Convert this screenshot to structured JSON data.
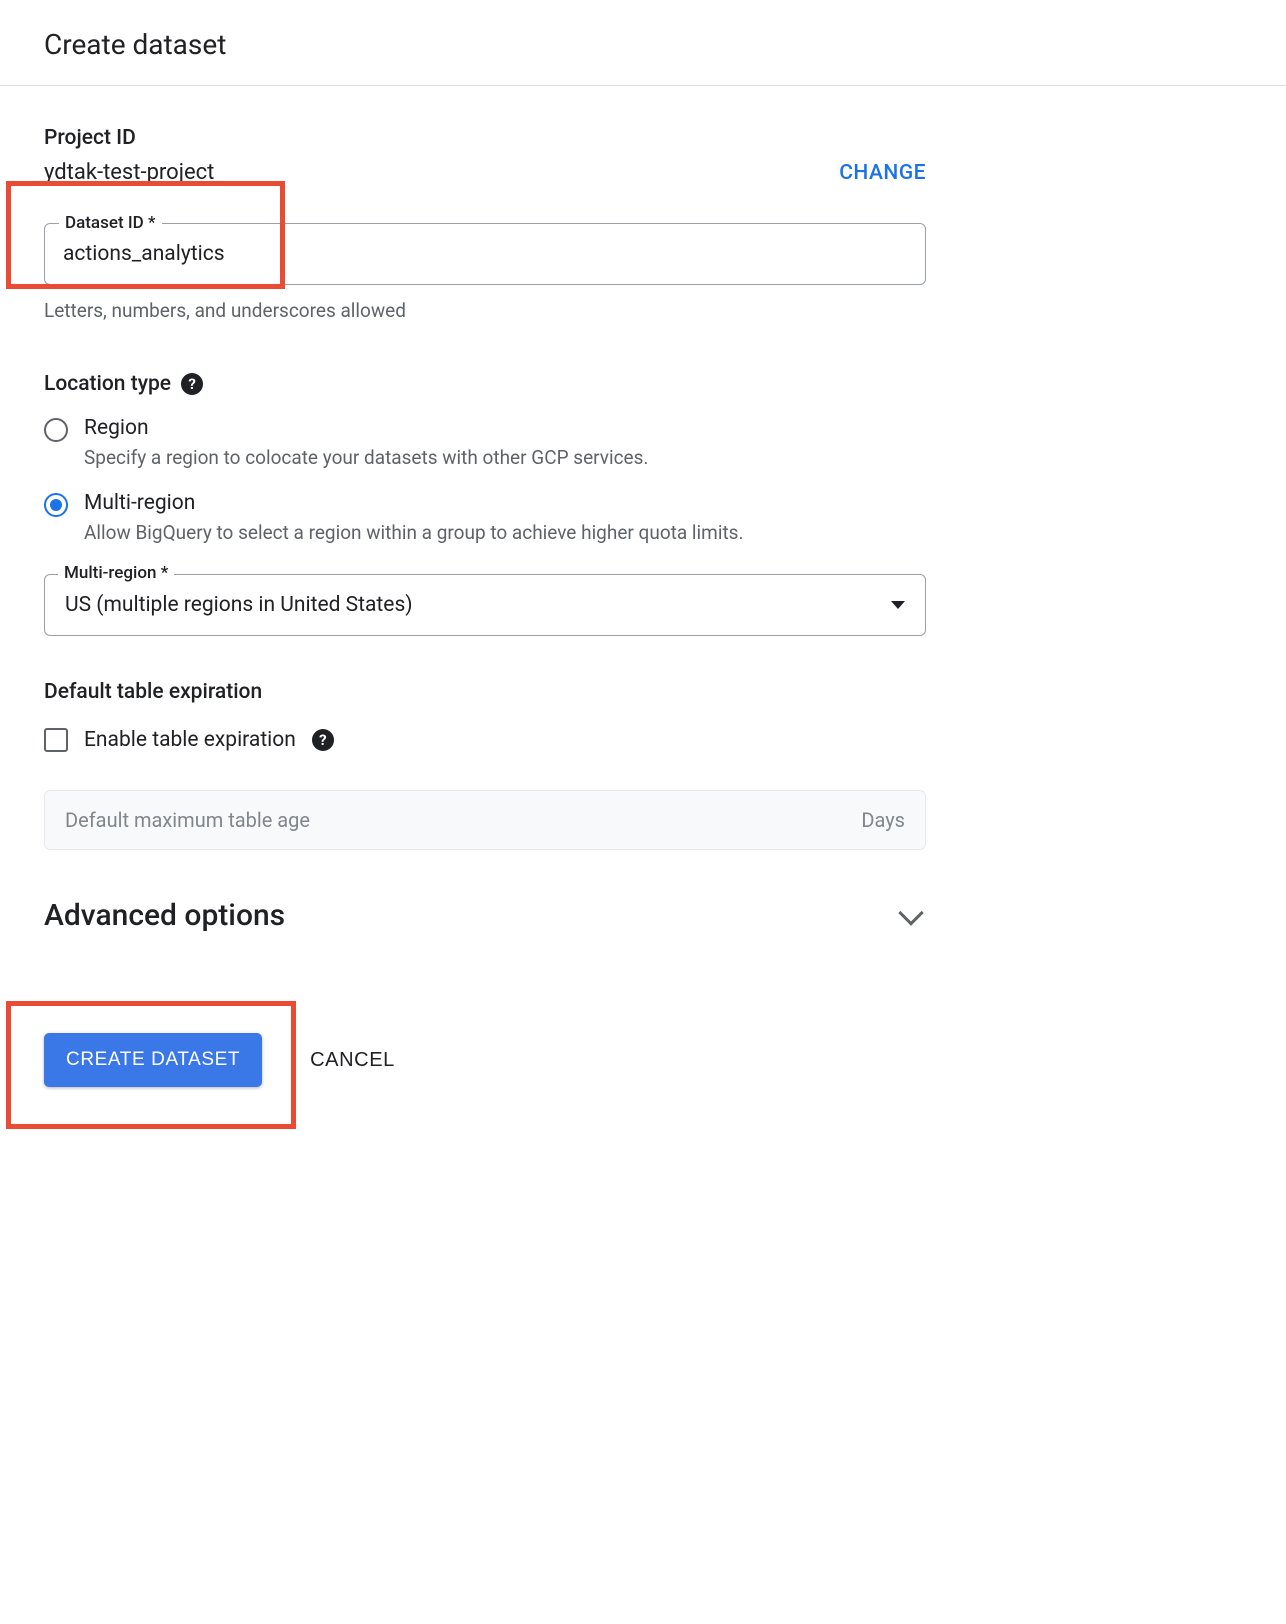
{
  "page": {
    "title": "Create dataset"
  },
  "project": {
    "label": "Project ID",
    "value": "ydtak-test-project",
    "change_label": "CHANGE"
  },
  "dataset_id": {
    "label": "Dataset ID *",
    "value": "actions_analytics",
    "helper": "Letters, numbers, and underscores allowed"
  },
  "location": {
    "section_label": "Location type",
    "options": [
      {
        "label": "Region",
        "desc": "Specify a region to colocate your datasets with other GCP services.",
        "selected": false
      },
      {
        "label": "Multi-region",
        "desc": "Allow BigQuery to select a region within a group to achieve higher quota limits.",
        "selected": true
      }
    ],
    "select_label": "Multi-region *",
    "select_value": "US (multiple regions in United States)"
  },
  "expiration": {
    "section_label": "Default table expiration",
    "checkbox_label": "Enable table expiration",
    "placeholder": "Default maximum table age",
    "suffix": "Days"
  },
  "advanced": {
    "label": "Advanced options"
  },
  "footer": {
    "primary": "CREATE DATASET",
    "cancel": "CANCEL"
  }
}
